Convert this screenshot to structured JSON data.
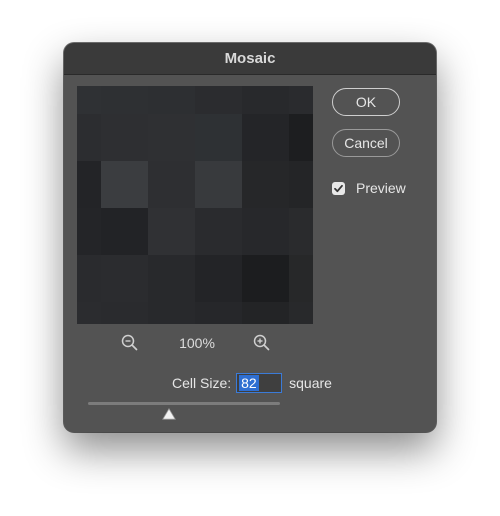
{
  "dialog": {
    "title": "Mosaic"
  },
  "buttons": {
    "ok_label": "OK",
    "cancel_label": "Cancel"
  },
  "preview_toggle": {
    "label": "Preview",
    "checked": true
  },
  "zoom": {
    "level": "100%",
    "zoom_out_icon": "zoom-out-magnifier",
    "zoom_in_icon": "zoom-in-magnifier"
  },
  "cell_size": {
    "label": "Cell Size:",
    "value": "82",
    "unit": "square",
    "slider_fraction": 0.42
  },
  "mosaic_preview": {
    "rows": [
      [
        "#2f3134",
        "#2e3033",
        "#2d2f32",
        "#2b2c2f",
        "#28292c",
        "#2a2b2e"
      ],
      [
        "#2c2d30",
        "#2e2f32",
        "#2f3033",
        "#2e3134",
        "#242528",
        "#1d1e20"
      ],
      [
        "#232427",
        "#3b3d40",
        "#2e2f32",
        "#383a3d",
        "#262729",
        "#242527"
      ],
      [
        "#242528",
        "#222326",
        "#303134",
        "#2a2b2e",
        "#27282b",
        "#2a2b2d"
      ],
      [
        "#2a2b2e",
        "#2b2c2f",
        "#28292c",
        "#232427",
        "#1c1d1f",
        "#272829"
      ],
      [
        "#2b2c2f",
        "#2a2b2e",
        "#28292c",
        "#26272a",
        "#232426",
        "#28292b"
      ]
    ]
  }
}
